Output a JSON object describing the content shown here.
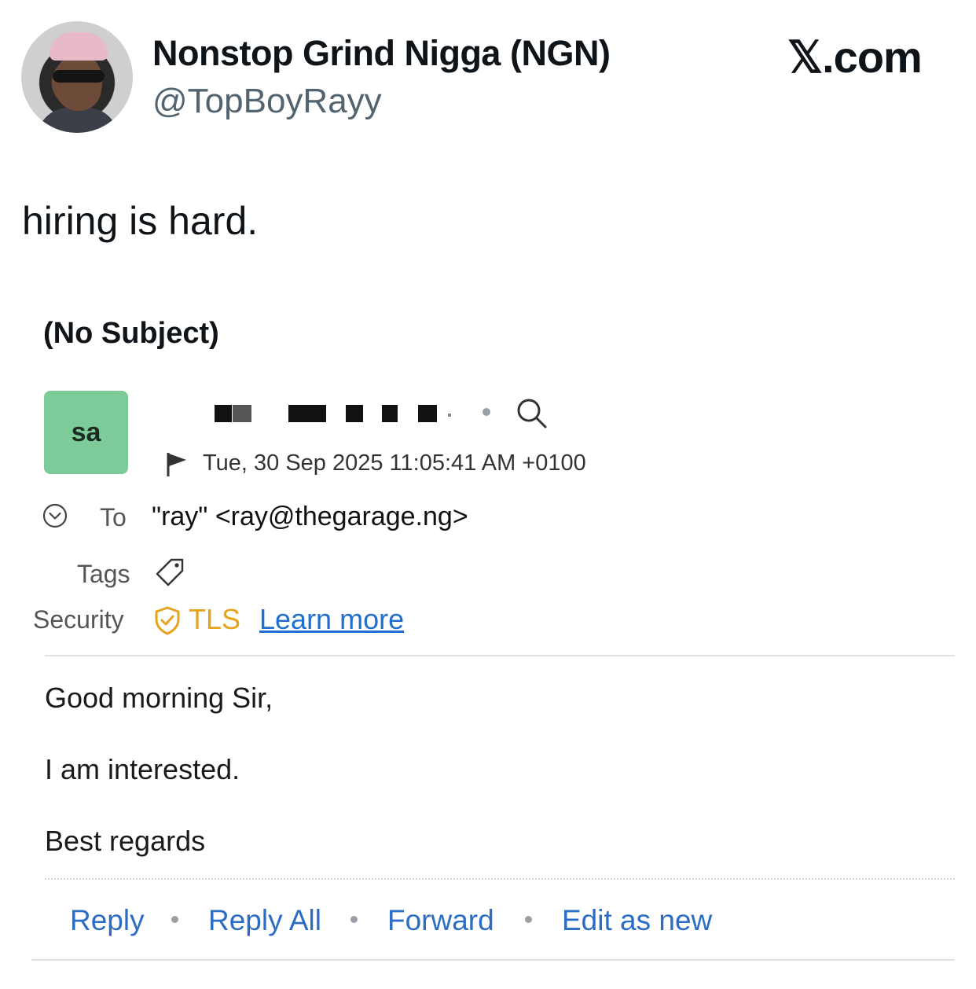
{
  "tweet": {
    "display_name": "Nonstop Grind Nigga (NGN)",
    "handle": "@TopBoyRayy",
    "brand": "𝕏.com",
    "text": "hiring is hard."
  },
  "email": {
    "subject": "(No Subject)",
    "sender_initials": "sa",
    "date": "Tue, 30 Sep 2025 11:05:41 AM +0100",
    "to_label": "To",
    "to_value": "\"ray\" <ray@thegarage.ng>",
    "tags_label": "Tags",
    "security_label": "Security",
    "security_value": "TLS",
    "learn_more": "Learn more",
    "body": [
      "Good morning Sir,",
      "I am interested.",
      "Best regards"
    ],
    "actions": {
      "reply": "Reply",
      "reply_all": "Reply All",
      "forward": "Forward",
      "edit_as_new": "Edit as new"
    }
  },
  "colors": {
    "avatar_green": "#7ccb98",
    "link_blue": "#2b6cc4",
    "tls_orange": "#e6a31e"
  }
}
